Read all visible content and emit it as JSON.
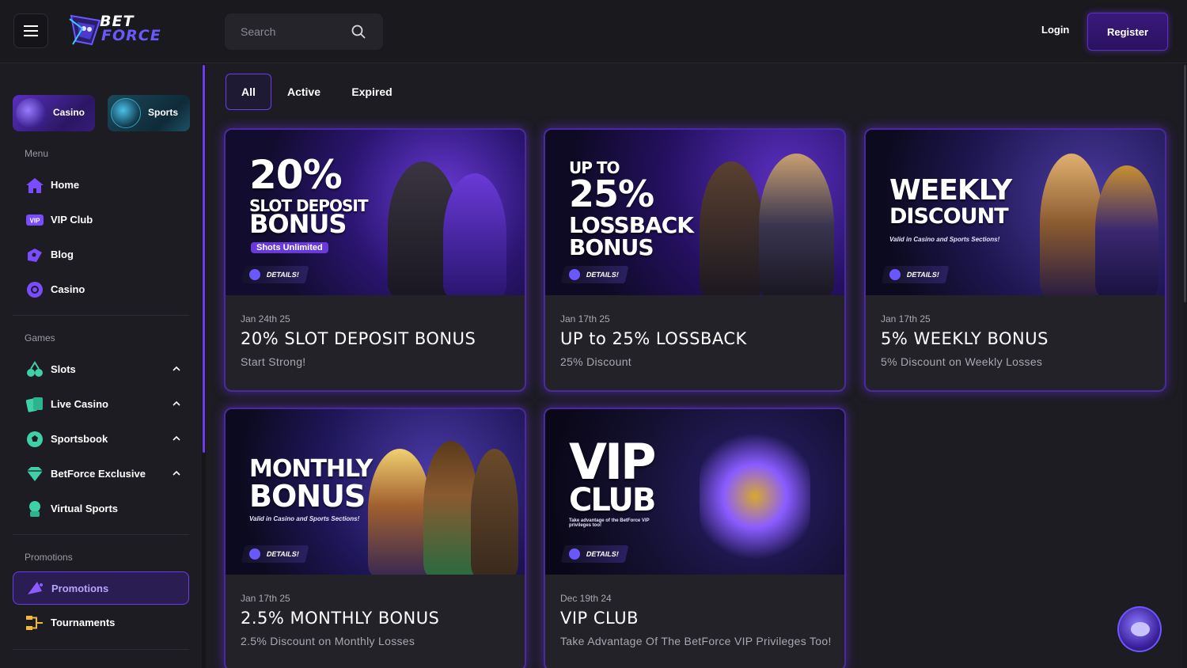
{
  "header": {
    "logo_top": "BET",
    "logo_bottom": "FORCE",
    "search_placeholder": "Search",
    "login_label": "Login",
    "register_label": "Register"
  },
  "sidebar": {
    "quick_pills": [
      {
        "label": "Casino"
      },
      {
        "label": "Sports"
      }
    ],
    "menu_title": "Menu",
    "menu_items": [
      {
        "label": "Home",
        "icon": "home-icon"
      },
      {
        "label": "VIP Club",
        "icon": "vip-icon"
      },
      {
        "label": "Blog",
        "icon": "blog-icon"
      },
      {
        "label": "Casino",
        "icon": "casino-chip-icon"
      }
    ],
    "games_title": "Games",
    "game_items": [
      {
        "label": "Slots",
        "icon": "slots-icon"
      },
      {
        "label": "Live Casino",
        "icon": "cards-icon"
      },
      {
        "label": "Sportsbook",
        "icon": "ball-icon"
      },
      {
        "label": "BetForce Exclusive",
        "icon": "diamond-icon"
      },
      {
        "label": "Virtual Sports",
        "icon": "virtual-sports-icon"
      }
    ],
    "promotions_title": "Promotions",
    "promo_items": [
      {
        "label": "Promotions",
        "icon": "megaphone-icon",
        "active": true
      },
      {
        "label": "Tournaments",
        "icon": "bracket-icon"
      }
    ]
  },
  "tabs": {
    "all": "All",
    "active": "Active",
    "expired": "Expired"
  },
  "cards": [
    {
      "banner_line1": "20%",
      "banner_line2": "SLOT DEPOSIT",
      "banner_line3": "BONUS",
      "banner_tag": "Shots Unlimited",
      "details": "DETAILS!",
      "date": "Jan 24th 25",
      "title": "20% SLOT DEPOSIT BONUS",
      "desc": "Start Strong!"
    },
    {
      "banner_line0": "UP TO",
      "banner_line1": "25%",
      "banner_line2": "LOSSBACK",
      "banner_line3": "BONUS",
      "details": "DETAILS!",
      "date": "Jan 17th 25",
      "title": "UP to 25% LOSSBACK",
      "desc": "25% Discount"
    },
    {
      "banner_line1": "WEEKLY",
      "banner_line2": "DISCOUNT",
      "banner_tag": "Valid in Casino and Sports Sections!",
      "details": "DETAILS!",
      "date": "Jan 17th 25",
      "title": "5% WEEKLY BONUS",
      "desc": "5% Discount on Weekly Losses"
    },
    {
      "banner_line1": "MONTHLY",
      "banner_line2": "BONUS",
      "banner_tag": "Valid in Casino and Sports Sections!",
      "details": "DETAILS!",
      "date": "Jan 17th 25",
      "title": "2.5% MONTHLY BONUS",
      "desc": "2.5% Discount on Monthly Losses"
    },
    {
      "banner_line1": "VIP",
      "banner_line2": "CLUB",
      "banner_tag": "Take advantage of the BetForce VIP privileges too!",
      "details": "DETAILS!",
      "date": "Dec 19th 24",
      "title": "VIP CLUB",
      "desc": "Take Advantage Of The BetForce VIP Privileges Too!"
    }
  ],
  "colors": {
    "accent": "#6b3cf0",
    "background": "#1d1c22",
    "card": "#232228"
  }
}
